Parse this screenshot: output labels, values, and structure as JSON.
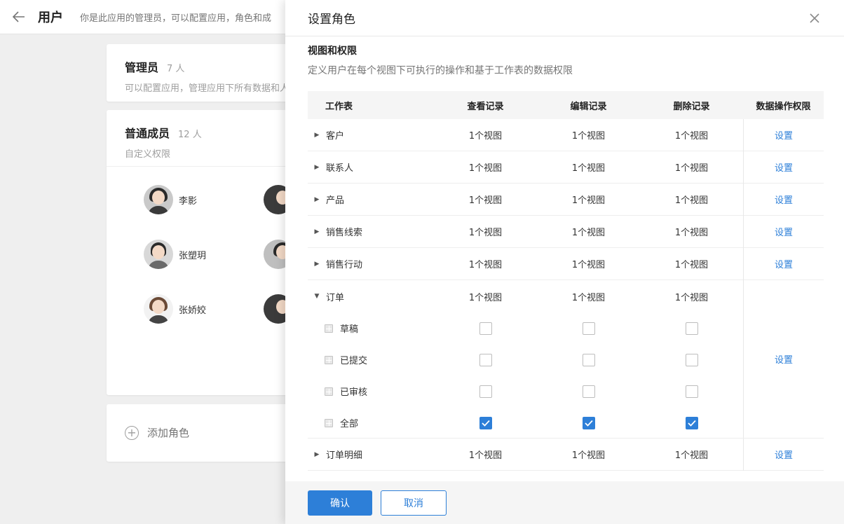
{
  "header": {
    "title": "用户",
    "description": "你是此应用的管理员，可以配置应用，角色和成"
  },
  "roles": {
    "admin": {
      "name": "管理员",
      "count": "7 人",
      "desc": "可以配置应用，管理应用下所有数据和人"
    },
    "members": {
      "name": "普通成员",
      "count": "12 人",
      "desc": "自定义权限"
    },
    "member_list": [
      {
        "name": "李影"
      },
      {
        "name": "张塑玥"
      },
      {
        "name": "张娇姣"
      }
    ],
    "add_label": "添加角色"
  },
  "drawer": {
    "title": "设置角色",
    "section_title": "视图和权限",
    "section_desc": "定义用户在每个视图下可执行的操作和基于工作表的数据权限",
    "columns": [
      "工作表",
      "查看记录",
      "编辑记录",
      "删除记录",
      "数据操作权限"
    ],
    "rows": [
      {
        "name": "客户",
        "view": "1个视图",
        "edit": "1个视图",
        "del": "1个视图",
        "action": "设置"
      },
      {
        "name": "联系人",
        "view": "1个视图",
        "edit": "1个视图",
        "del": "1个视图",
        "action": "设置"
      },
      {
        "name": "产品",
        "view": "1个视图",
        "edit": "1个视图",
        "del": "1个视图",
        "action": "设置"
      },
      {
        "name": "销售线索",
        "view": "1个视图",
        "edit": "1个视图",
        "del": "1个视图",
        "action": "设置"
      },
      {
        "name": "销售行动",
        "view": "1个视图",
        "edit": "1个视图",
        "del": "1个视图",
        "action": "设置"
      }
    ],
    "order": {
      "name": "订单",
      "view": "1个视图",
      "edit": "1个视图",
      "del": "1个视图",
      "action": "设置",
      "subviews": [
        {
          "name": "草稿",
          "view": false,
          "edit": false,
          "del": false
        },
        {
          "name": "已提交",
          "view": false,
          "edit": false,
          "del": false
        },
        {
          "name": "已审核",
          "view": false,
          "edit": false,
          "del": false
        },
        {
          "name": "全部",
          "view": true,
          "edit": true,
          "del": true
        }
      ]
    },
    "last_row": {
      "name": "订单明细",
      "view": "1个视图",
      "edit": "1个视图",
      "del": "1个视图",
      "action": "设置"
    },
    "confirm_label": "确认",
    "cancel_label": "取消"
  },
  "colors": {
    "accent": "#2d7fd8"
  }
}
